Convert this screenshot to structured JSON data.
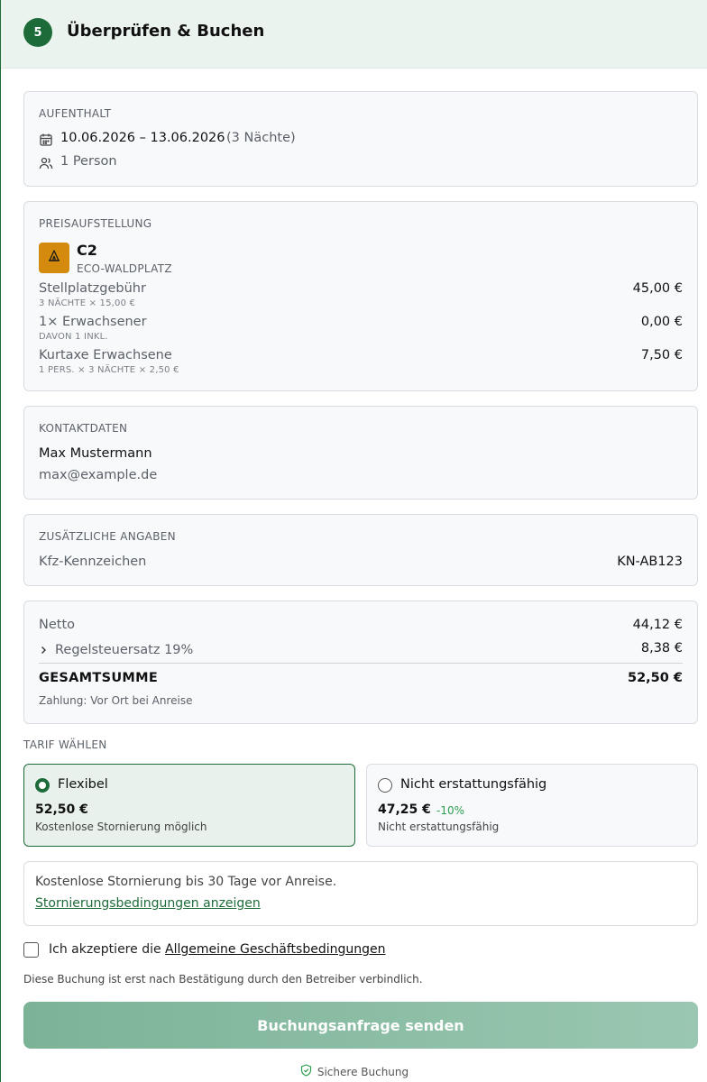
{
  "header": {
    "step": "5",
    "title": "Überprüfen & Buchen"
  },
  "stay": {
    "label": "AUFENTHALT",
    "dates": "10.06.2026 – 13.06.2026",
    "nights": "(3 Nächte)",
    "persons": "1 Person"
  },
  "pricing": {
    "label": "PREISAUFSTELLUNG",
    "site_code": "C2",
    "site_type": "ECO-WALDPLATZ",
    "lines": [
      {
        "name": "Stellplatzgebühr",
        "detail": "3 NÄCHTE × 15,00 €",
        "amount": "45,00 €"
      },
      {
        "name": "1× Erwachsener",
        "detail": "DAVON 1 INKL.",
        "amount": "0,00 €"
      },
      {
        "name": "Kurtaxe Erwachsene",
        "detail": "1 PERS. × 3 NÄCHTE × 2,50 €",
        "amount": "7,50 €"
      }
    ]
  },
  "contact": {
    "label": "KONTAKTDATEN",
    "name": "Max Mustermann",
    "email": "max@example.de"
  },
  "additional": {
    "label": "ZUSÄTZLICHE ANGABEN",
    "plate_label": "Kfz-Kennzeichen",
    "plate_value": "KN-AB123"
  },
  "totals": {
    "net_label": "Netto",
    "net_value": "44,12 €",
    "tax_label": "Regelsteuersatz 19%",
    "tax_value": "8,38 €",
    "total_label": "GESAMTSUMME",
    "total_value": "52,50 €",
    "payment": "Zahlung: Vor Ort bei Anreise"
  },
  "tariff": {
    "label": "TARIF WÄHLEN",
    "options": [
      {
        "name": "Flexibel",
        "price": "52,50 €",
        "discount": "",
        "desc": "Kostenlose Stornierung möglich",
        "selected": true
      },
      {
        "name": "Nicht erstattungsfähig",
        "price": "47,25 €",
        "discount": "-10%",
        "desc": "Nicht erstattungsfähig",
        "selected": false
      }
    ]
  },
  "cancellation": {
    "text": "Kostenlose Stornierung bis 30 Tage vor Anreise.",
    "link": "Stornierungsbedingungen anzeigen"
  },
  "terms": {
    "prefix": "Ich akzeptiere die",
    "link": "Allgemeine Geschäftsbedingungen"
  },
  "notice": "Diese Buchung ist erst nach Bestätigung durch den Betreiber verbindlich.",
  "submit_label": "Buchungsanfrage senden",
  "secure_label": "Sichere Buchung",
  "colors": {
    "brand": "#1e6b3a",
    "discount": "#2e9e4f",
    "button": "#8bbda4"
  }
}
